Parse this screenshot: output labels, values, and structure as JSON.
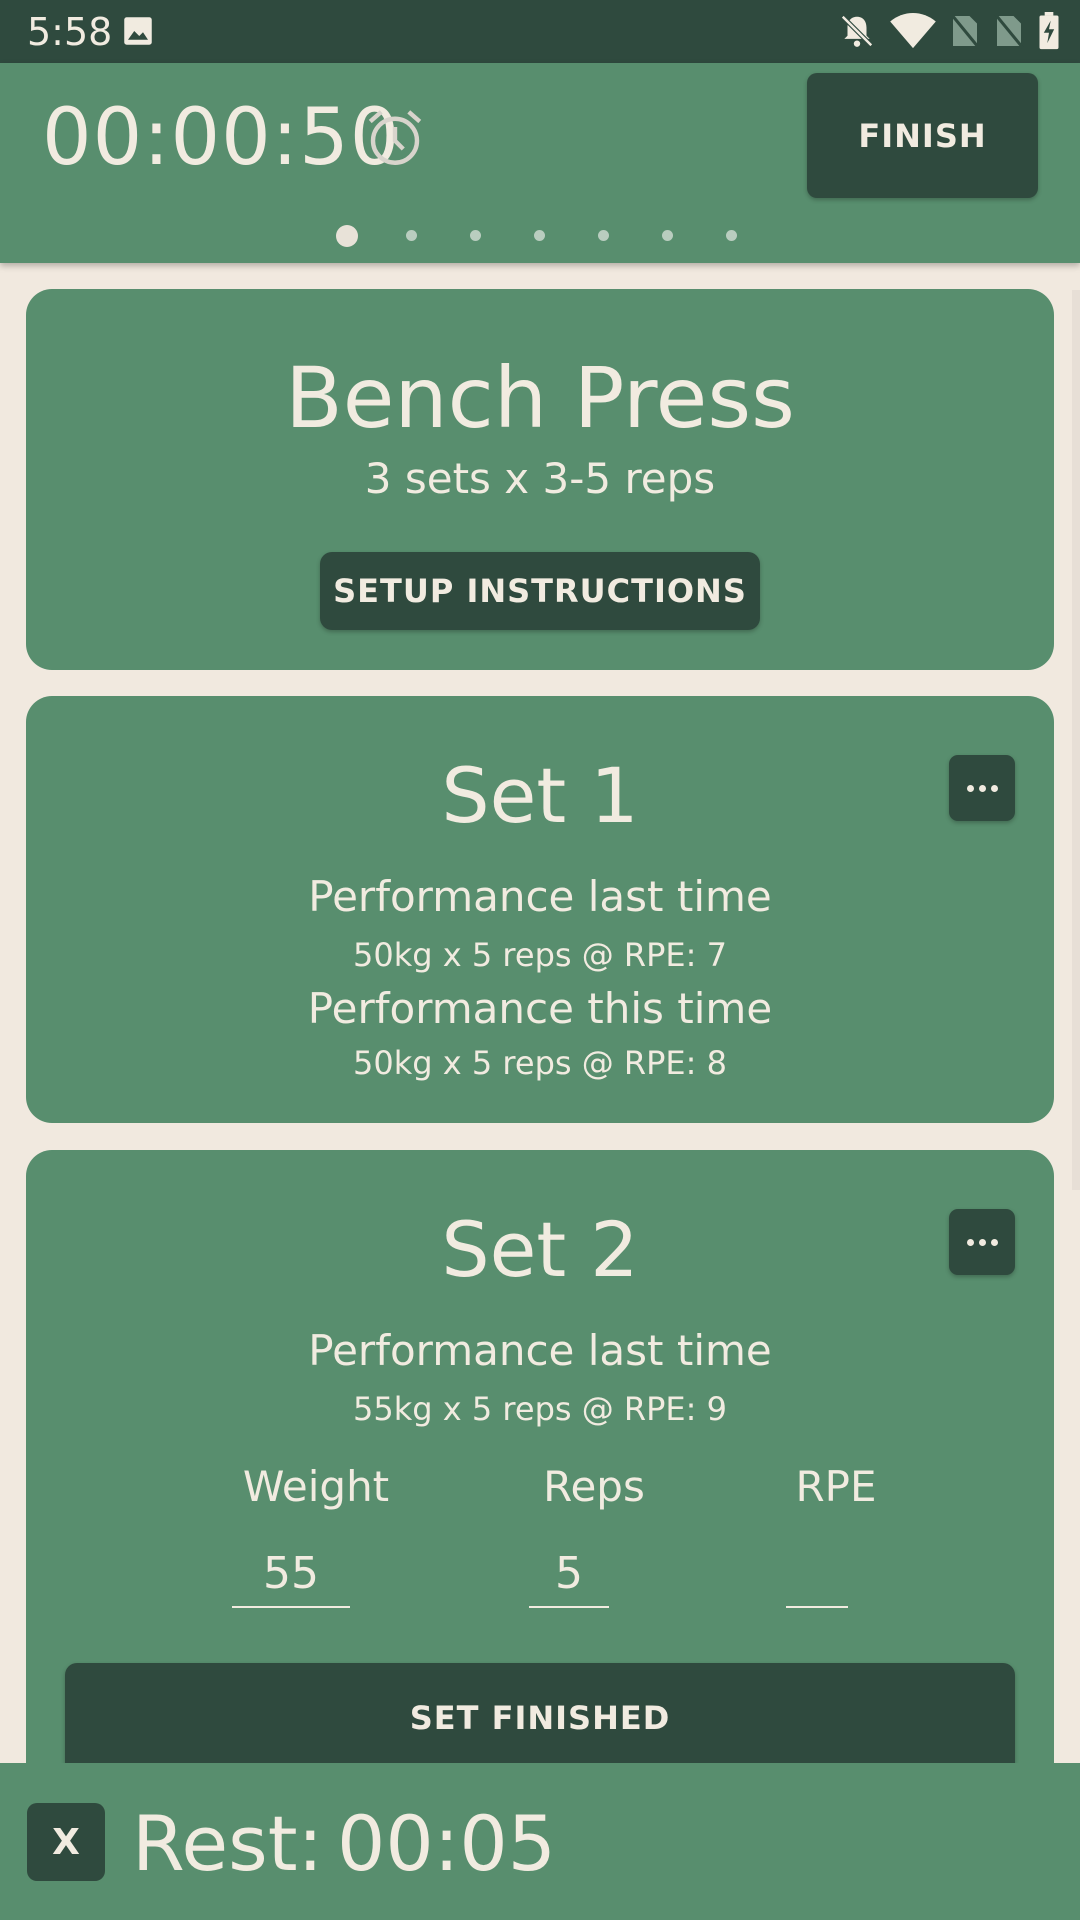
{
  "status_bar": {
    "time": "5:58",
    "icons": [
      "image-icon",
      "notifications-off-icon",
      "wifi-icon",
      "no-sim-icon",
      "no-sim-icon",
      "battery-charging-icon"
    ]
  },
  "header": {
    "elapsed_time": "00:00:50",
    "alarm_icon": "alarm-icon",
    "finish_label": "FINISH",
    "page_dots": {
      "count": 7,
      "active_index": 0
    }
  },
  "exercise": {
    "name": "Bench Press",
    "scheme": "3 sets x 3-5 reps",
    "setup_label": "SETUP INSTRUCTIONS"
  },
  "sets": [
    {
      "title": "Set 1",
      "last_label": "Performance last time",
      "last_value": "50kg x 5 reps @ RPE: 7",
      "this_label": "Performance this time",
      "this_value": "50kg x 5 reps @ RPE: 8"
    },
    {
      "title": "Set 2",
      "last_label": "Performance last time",
      "last_value": "55kg x 5 reps @ RPE: 9",
      "fields": {
        "weight_label": "Weight",
        "weight_value": "55",
        "reps_label": "Reps",
        "reps_value": "5",
        "rpe_label": "RPE",
        "rpe_value": ""
      },
      "finish_label": "SET FINISHED"
    }
  ],
  "rest": {
    "close_label": "X",
    "label": "Rest:",
    "time": "00:05"
  },
  "colors": {
    "primary": "#588e6e",
    "dark": "#2f4a3e",
    "background": "#f1e9df",
    "text": "#f1ebe0"
  }
}
